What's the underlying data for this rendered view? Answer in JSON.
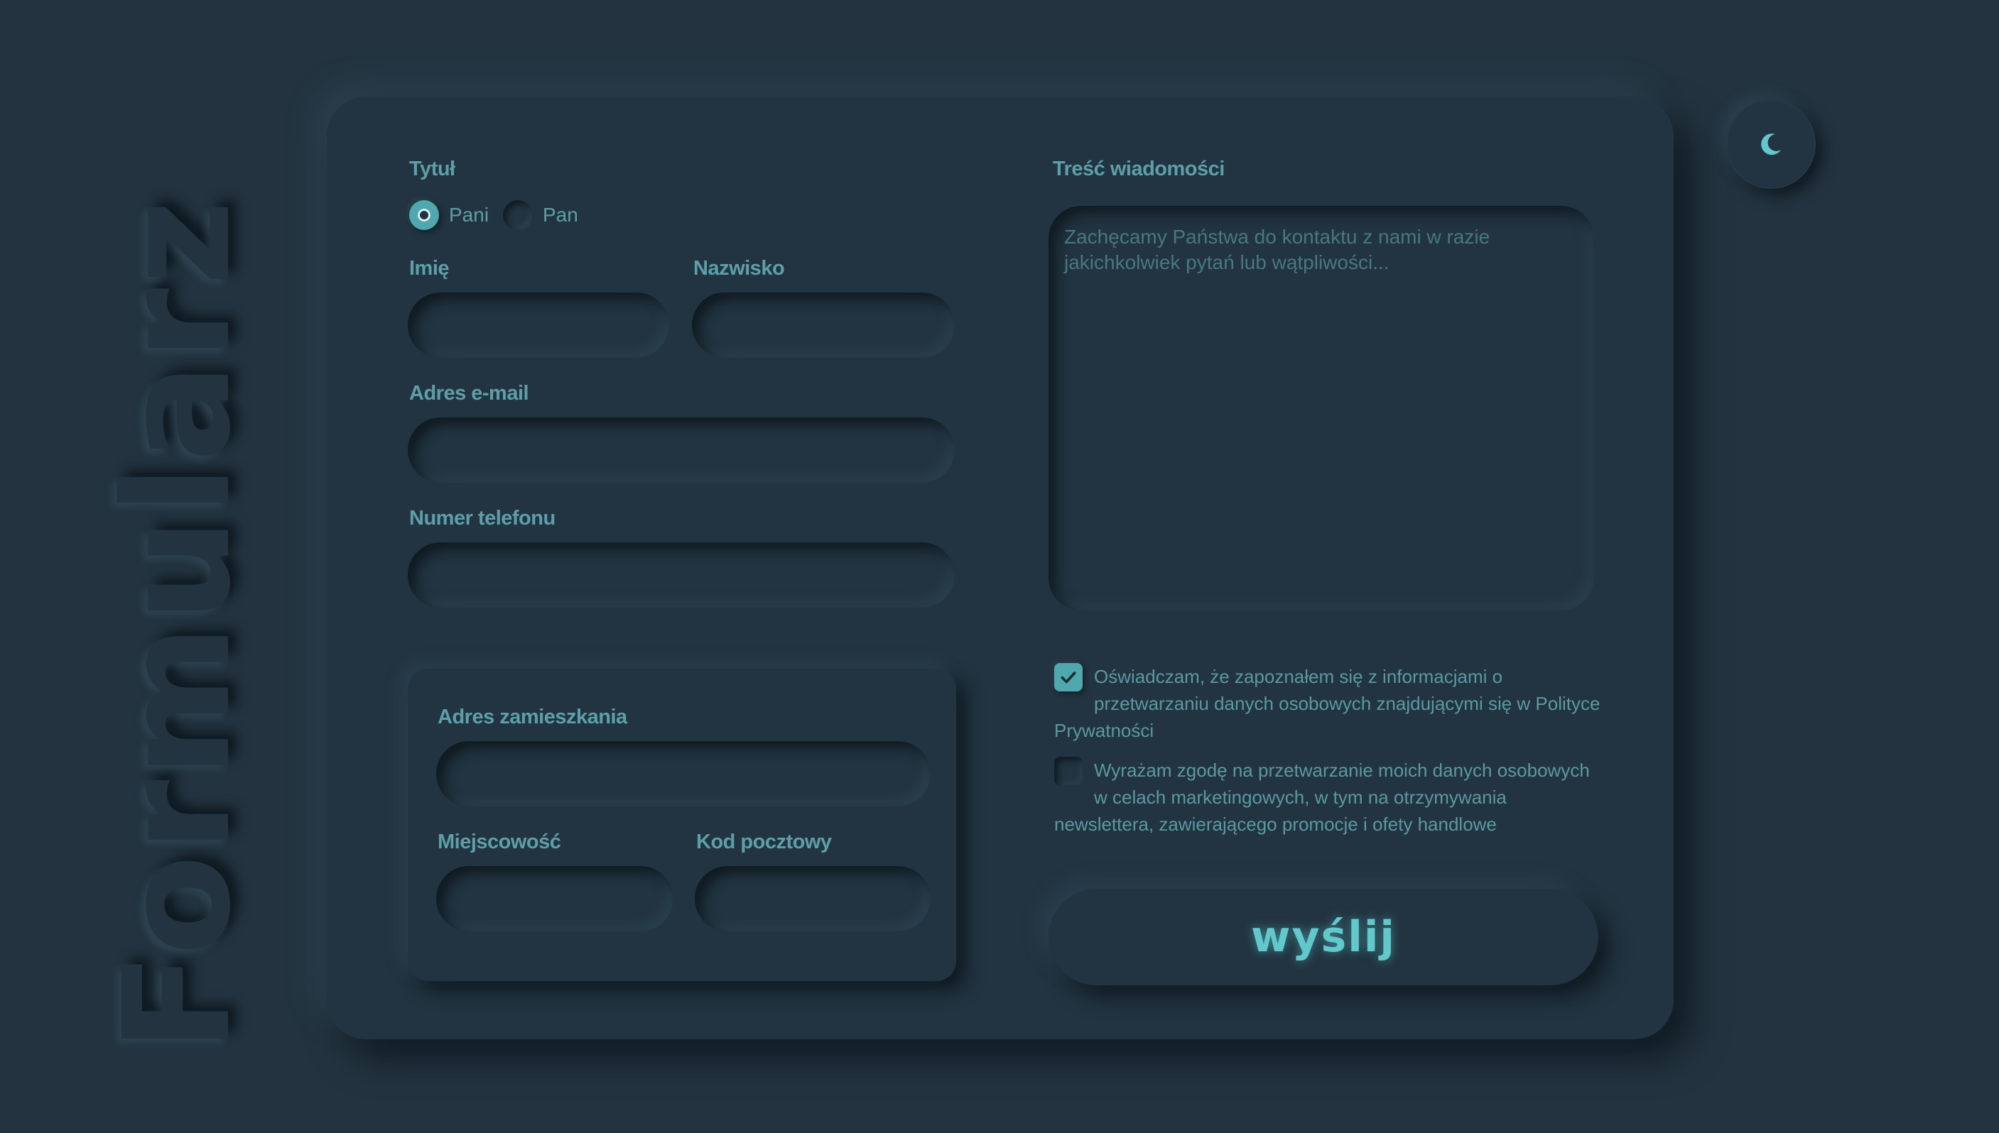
{
  "side_title": "Formularz",
  "form": {
    "title_label": "Tytuł",
    "radio_options": [
      "Pani",
      "Pan"
    ],
    "selected_title": "Pani",
    "first_name_label": "Imię",
    "last_name_label": "Nazwisko",
    "email_label": "Adres e-mail",
    "phone_label": "Numer telefonu",
    "first_name_value": "",
    "last_name_value": "",
    "email_value": "",
    "phone_value": ""
  },
  "address": {
    "street_label": "Adres zamieszkania",
    "city_label": "Miejscowość",
    "postal_label": "Kod pocztowy",
    "street_value": "",
    "city_value": "",
    "postal_value": ""
  },
  "message": {
    "label": "Treść wiadomości",
    "placeholder": "Zachęcamy Państwa do kontaktu z nami w razie jakichkolwiek pytań lub wątpliwości...",
    "value": ""
  },
  "consents": [
    {
      "checked": true,
      "text": "Oświadczam, że zapoznałem się z informacjami o przetwarzaniu danych osobowych znajdującymi się w Polityce Prywatności"
    },
    {
      "checked": false,
      "text": "Wyrażam zgodę na przetwarzanie moich danych osobowych w celach marketingowych, w tym na otrzymywania newslettera, zawierającego promocje i ofety handlowe"
    }
  ],
  "submit_label": "wyślij",
  "theme_toggle_icon": "moon-icon",
  "colors": {
    "background": "#233440",
    "accent": "#4fa8ad",
    "label": "#5d9fa8",
    "button_text": "#62c8cc"
  }
}
